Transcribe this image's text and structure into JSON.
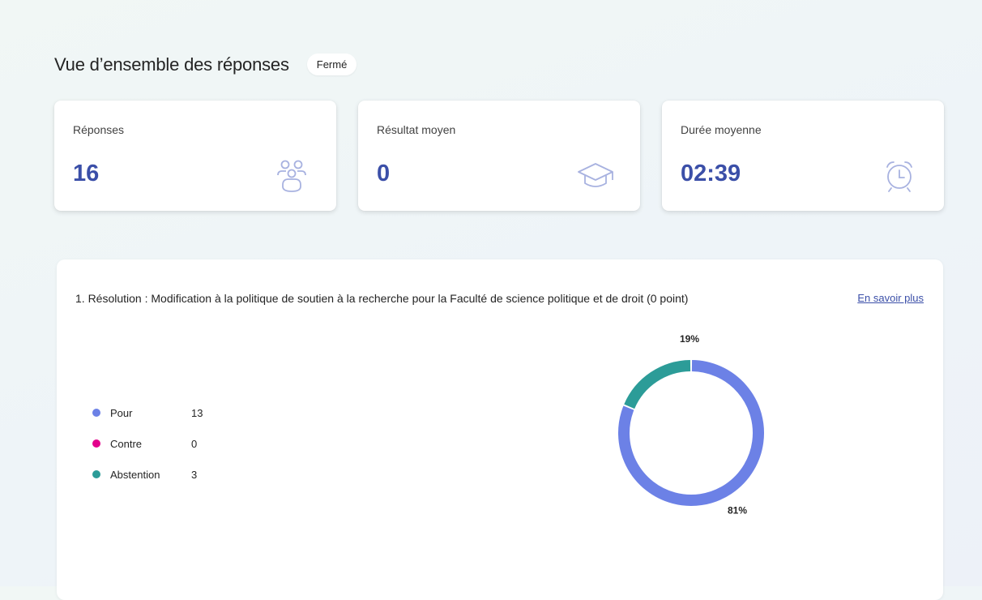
{
  "header": {
    "title": "Vue d’ensemble des réponses",
    "status": "Fermé"
  },
  "stats": [
    {
      "label": "Réponses",
      "value": "16",
      "icon": "people-icon"
    },
    {
      "label": "Résultat moyen",
      "value": "0",
      "icon": "graduation-cap-icon"
    },
    {
      "label": "Durée moyenne",
      "value": "02:39",
      "icon": "alarm-clock-icon"
    }
  ],
  "question": {
    "title": "1. Résolution : Modification à la politique de soutien à la recherche pour la Faculté de science politique et de droit (0 point)",
    "learn_more": "En savoir plus"
  },
  "colors": {
    "accent": "#3b4fa8",
    "icon": "#a8b2e0"
  },
  "chart_data": {
    "type": "pie",
    "donut": true,
    "categories": [
      "Pour",
      "Contre",
      "Abstention"
    ],
    "values": [
      13,
      0,
      3
    ],
    "colors": [
      "#6c81e6",
      "#e3008c",
      "#2c9c98"
    ],
    "slice_labels": [
      {
        "category": "Pour",
        "text": "81%"
      },
      {
        "category": "Abstention",
        "text": "19%"
      }
    ],
    "legend_position": "left"
  }
}
